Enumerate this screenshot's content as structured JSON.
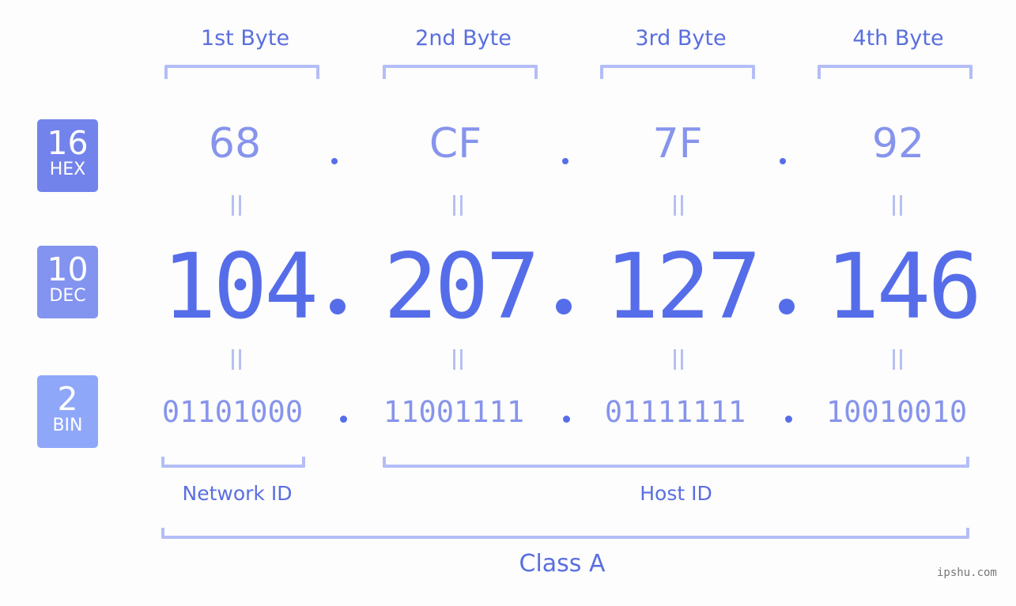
{
  "ip": {
    "decimal": "104.207.127.146",
    "bytes": [
      {
        "header": "1st Byte",
        "hex": "68",
        "dec": "104",
        "bin": "01101000"
      },
      {
        "header": "2nd Byte",
        "hex": "CF",
        "dec": "207",
        "bin": "11001111"
      },
      {
        "header": "3rd Byte",
        "hex": "7F",
        "dec": "127",
        "bin": "01111111"
      },
      {
        "header": "4th Byte",
        "hex": "92",
        "dec": "146",
        "bin": "10010010"
      }
    ],
    "separator": ".",
    "equals_symbol": "="
  },
  "badges": [
    {
      "base": "16",
      "label": "HEX",
      "color": "#7383ec"
    },
    {
      "base": "10",
      "label": "DEC",
      "color": "#8393f0"
    },
    {
      "base": "2",
      "label": "BIN",
      "color": "#8fa7f8"
    }
  ],
  "sections": {
    "network_id": "Network ID",
    "host_id": "Host ID",
    "class": "Class A"
  },
  "watermark": "ipshu.com",
  "colors": {
    "accent": "#566dea",
    "light_value": "#8794ec",
    "bracket": "#b3bdf7",
    "label": "#5a6ee0"
  }
}
